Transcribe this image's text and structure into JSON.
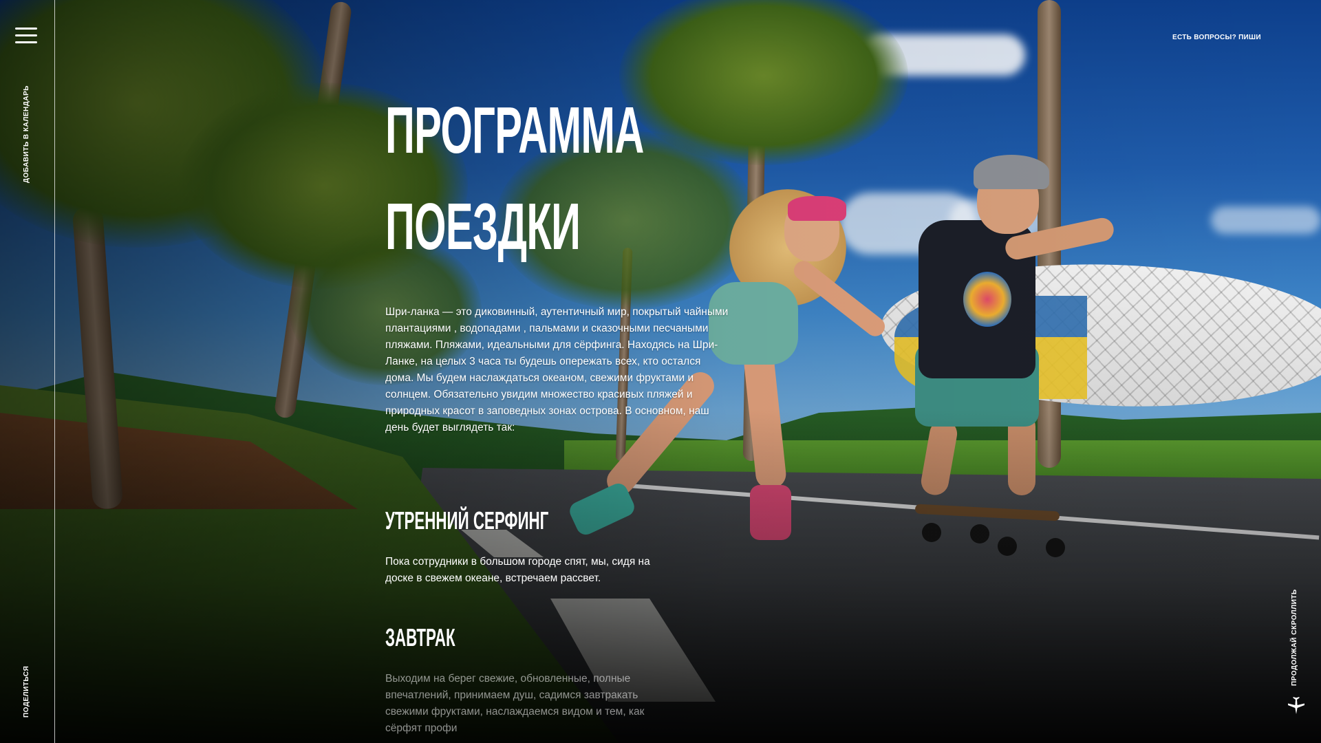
{
  "nav": {
    "menu_icon": "hamburger-menu-icon",
    "add_to_calendar": "ДОБАВИТЬ В КАЛЕНДАРЬ",
    "share": "ПОДЕЛИТЬСЯ",
    "contact": "ЕСТЬ ВОПРОСЫ? ПИШИ",
    "scroll_hint": "ПРОДОЛЖАЙ СКРОЛЛИТЬ",
    "scroll_icon": "airplane-icon"
  },
  "main": {
    "title_lines": [
      "ПРОГРАММА",
      "ПОЕЗДКИ"
    ],
    "intro": "Шри-ланка — это диковинный, аутентичный мир, покрытый чайными плантациями , водопадами , пальмами и сказочными песчаными пляжами. Пляжами, идеальными для сёрфинга. Находясь на Шри-Ланке, на целых 3 часа ты будешь опережать всех, кто остался дома. Мы будем наслаждаться океаном, свежими фруктами и солнцем. Обязательно увидим множество красивых пляжей и природных красот в заповедных зонах острова. В основном, наш день будет выглядеть так:",
    "sections": [
      {
        "heading": "УТРЕННИЙ СЕРФИНГ",
        "text": "Пока сотрудники в большом городе спят, мы, сидя на доске в свежем океане, встречаем рассвет."
      },
      {
        "heading": "ЗАВТРАК",
        "text": "Выходим на берег свежие, обновленные, полные впечатлений, принимаем душ, садимся завтракать свежими фруктами, наслаждаемся видом и тем, как сёрфят профи"
      }
    ]
  },
  "colors": {
    "text": "#ffffff",
    "overlay": "#000000"
  }
}
